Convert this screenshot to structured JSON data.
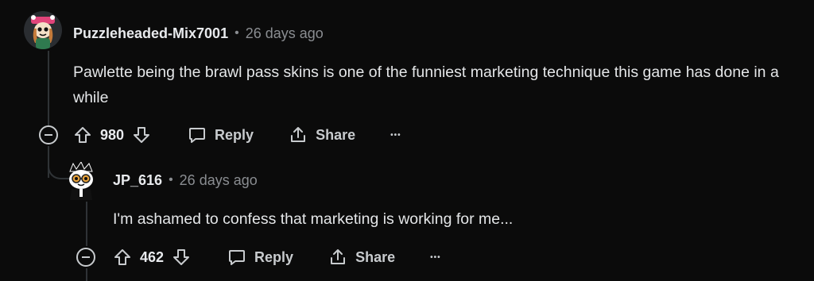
{
  "comments": [
    {
      "author": "Puzzleheaded-Mix7001",
      "separator": "•",
      "time": "26 days ago",
      "body": "Pawlette being the brawl pass skins is one of the funniest marketing technique this game has done in a while",
      "score": "980",
      "reply_label": "Reply",
      "share_label": "Share",
      "more_label": "•••"
    },
    {
      "author": "JP_616",
      "separator": "•",
      "time": "26 days ago",
      "body": "I'm ashamed to confess that marketing is working for me...",
      "score": "462",
      "reply_label": "Reply",
      "share_label": "Share",
      "more_label": "•••"
    }
  ],
  "icons": {
    "upvote": "arrow-up-icon",
    "downvote": "arrow-down-icon",
    "reply": "speech-bubble-icon",
    "share": "share-icon",
    "collapse": "minus-circle-icon"
  }
}
